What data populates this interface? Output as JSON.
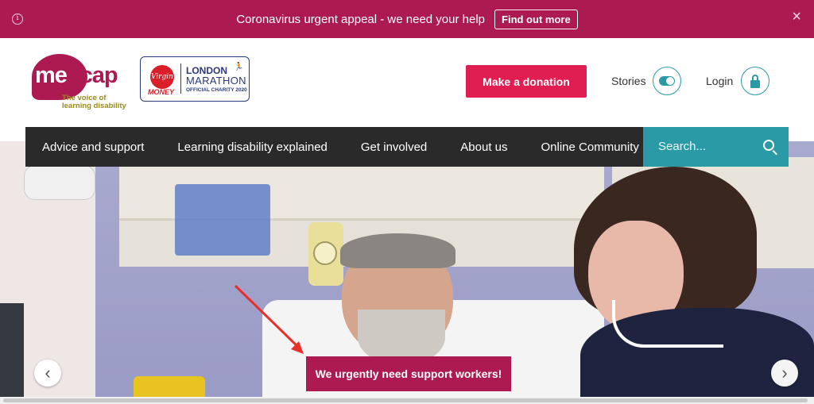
{
  "alert": {
    "info_glyph": "i",
    "message": "Coronavirus urgent appeal - we need your help",
    "cta_label": "Find out more",
    "close_glyph": "×"
  },
  "header": {
    "logo": {
      "wordmark_lead": "me",
      "wordmark_rest": "ncap",
      "tagline": "The voice of learning disability"
    },
    "marathon_badge": {
      "virgin": "Virgin",
      "money": "MONEY",
      "line1": "LONDON",
      "line2": "MARATHON",
      "line3": "OFFICIAL CHARITY  2020"
    },
    "donate_label": "Make a donation",
    "stories_label": "Stories",
    "login_label": "Login"
  },
  "nav": {
    "items": [
      "Advice and support",
      "Learning disability explained",
      "Get involved",
      "About us",
      "Online Community"
    ],
    "search_placeholder": "Search..."
  },
  "hero": {
    "banner_label": "We urgently need support workers!",
    "prev_glyph": "‹",
    "next_glyph": "›"
  },
  "colors": {
    "brand": "#ad1a52",
    "donate": "#e01e52",
    "teal": "#2a9aa7",
    "nav": "#2a2a2a"
  }
}
